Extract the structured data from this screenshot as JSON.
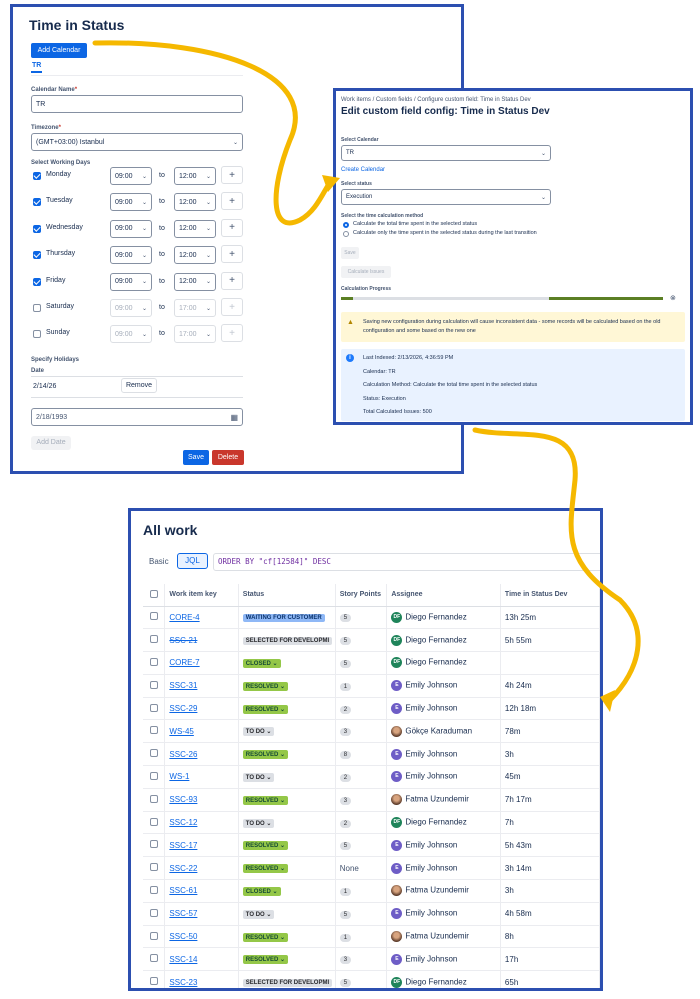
{
  "panel1": {
    "title": "Time in Status",
    "add_calendar_button": "Add Calendar",
    "tab_tr": "TR",
    "calendar_name_label": "Calendar Name",
    "required_mark": "*",
    "calendar_name_value": "TR",
    "timezone_label": "Timezone",
    "timezone_value": "(GMT+03:00) Istanbul",
    "working_days_label": "Select Working Days",
    "to_label": "to",
    "days": [
      {
        "name": "Monday",
        "checked": true,
        "start": "09:00",
        "end": "12:00"
      },
      {
        "name": "Tuesday",
        "checked": true,
        "start": "09:00",
        "end": "12:00"
      },
      {
        "name": "Wednesday",
        "checked": true,
        "start": "09:00",
        "end": "12:00"
      },
      {
        "name": "Thursday",
        "checked": true,
        "start": "09:00",
        "end": "12:00"
      },
      {
        "name": "Friday",
        "checked": true,
        "start": "09:00",
        "end": "12:00"
      },
      {
        "name": "Saturday",
        "checked": false,
        "start": "09:00",
        "end": "17:00"
      },
      {
        "name": "Sunday",
        "checked": false,
        "start": "09:00",
        "end": "17:00"
      }
    ],
    "holidays_label": "Specify Holidays",
    "date_label": "Date",
    "holiday_date": "2/14/26",
    "remove_button": "Remove",
    "date_input_value": "2/18/1993",
    "add_date_button": "Add Date",
    "save_button": "Save",
    "delete_button": "Delete"
  },
  "panel2": {
    "breadcrumb": [
      "Work items",
      "Custom fields",
      "Configure custom field: Time in Status Dev"
    ],
    "breadcrumb_sep": "/",
    "title": "Edit custom field config: Time in Status Dev",
    "select_calendar_label": "Select Calendar",
    "calendar_value": "TR",
    "create_calendar_link": "Create Calendar",
    "select_status_label": "Select status",
    "status_value": "Execution",
    "method_label": "Select the time calculation method",
    "method_options": [
      {
        "label": "Calculate the total time spent in the selected status",
        "selected": true
      },
      {
        "label": "Calculate only the time spent in the selected status during the last transition",
        "selected": false
      }
    ],
    "save_button": "Save",
    "calculate_button": "Calculate Issues",
    "progress_label": "Calculation Progress",
    "warning_text": "Saving new configuration during calculation will cause inconsistent data - some records will be calculated based on the old configuration and some based on the new one",
    "info": [
      "Last Indexed: 2/13/2026, 4:36:59 PM",
      "Calendar: TR",
      "Calculation Method: Calculate the total time spent in the selected status",
      "Status: Execution",
      "Total Calculated Issues: 500"
    ]
  },
  "panel3": {
    "title": "All work",
    "basic_label": "Basic",
    "jql_label": "JQL",
    "query": "ORDER BY \"cf[12584]\" DESC",
    "columns": [
      "Work item key",
      "Status",
      "Story Points",
      "Assignee",
      "Time in Status Dev"
    ],
    "rows": [
      {
        "key": "CORE-4",
        "strike": false,
        "status": "WAITING FOR CUSTOMER",
        "status_color": "blue",
        "chevron": false,
        "points": "5",
        "assignee": "Diego Fernandez",
        "avatar": "DF",
        "time": "13h 25m"
      },
      {
        "key": "SSC-21",
        "strike": true,
        "status": "SELECTED FOR DEVELOPMI",
        "status_color": "grey",
        "chevron": false,
        "points": "5",
        "assignee": "Diego Fernandez",
        "avatar": "DF",
        "time": "5h 55m"
      },
      {
        "key": "CORE-7",
        "strike": false,
        "status": "CLOSED",
        "status_color": "green",
        "chevron": true,
        "points": "5",
        "assignee": "Diego Fernandez",
        "avatar": "DF",
        "time": ""
      },
      {
        "key": "SSC-31",
        "strike": false,
        "status": "RESOLVED",
        "status_color": "green",
        "chevron": true,
        "points": "1",
        "assignee": "Emily Johnson",
        "avatar": "E",
        "time": "4h 24m"
      },
      {
        "key": "SSC-29",
        "strike": false,
        "status": "RESOLVED",
        "status_color": "green",
        "chevron": true,
        "points": "2",
        "assignee": "Emily Johnson",
        "avatar": "E",
        "time": "12h 18m"
      },
      {
        "key": "WS-45",
        "strike": false,
        "status": "TO DO",
        "status_color": "grey",
        "chevron": true,
        "points": "3",
        "assignee": "Gökçe Karaduman",
        "avatar": "photo",
        "time": "78m"
      },
      {
        "key": "SSC-26",
        "strike": false,
        "status": "RESOLVED",
        "status_color": "green",
        "chevron": true,
        "points": "8",
        "assignee": "Emily Johnson",
        "avatar": "E",
        "time": "3h"
      },
      {
        "key": "WS-1",
        "strike": false,
        "status": "TO DO",
        "status_color": "grey",
        "chevron": true,
        "points": "2",
        "assignee": "Emily Johnson",
        "avatar": "E",
        "time": "45m"
      },
      {
        "key": "SSC-93",
        "strike": false,
        "status": "RESOLVED",
        "status_color": "green",
        "chevron": true,
        "points": "3",
        "assignee": "Fatma Uzundemir",
        "avatar": "photo",
        "time": "7h 17m"
      },
      {
        "key": "SSC-12",
        "strike": false,
        "status": "TO DO",
        "status_color": "grey",
        "chevron": true,
        "points": "2",
        "assignee": "Diego Fernandez",
        "avatar": "DF",
        "time": "7h"
      },
      {
        "key": "SSC-17",
        "strike": false,
        "status": "RESOLVED",
        "status_color": "green",
        "chevron": true,
        "points": "5",
        "assignee": "Emily Johnson",
        "avatar": "E",
        "time": "5h 43m"
      },
      {
        "key": "SSC-22",
        "strike": false,
        "status": "RESOLVED",
        "status_color": "green",
        "chevron": true,
        "points": "None",
        "assignee": "Emily Johnson",
        "avatar": "E",
        "time": "3h 14m"
      },
      {
        "key": "SSC-61",
        "strike": false,
        "status": "CLOSED",
        "status_color": "green",
        "chevron": true,
        "points": "1",
        "assignee": "Fatma Uzundemir",
        "avatar": "photo",
        "time": "3h"
      },
      {
        "key": "SSC-57",
        "strike": false,
        "status": "TO DO",
        "status_color": "grey",
        "chevron": true,
        "points": "5",
        "assignee": "Emily Johnson",
        "avatar": "E",
        "time": "4h 58m"
      },
      {
        "key": "SSC-50",
        "strike": false,
        "status": "RESOLVED",
        "status_color": "green",
        "chevron": true,
        "points": "1",
        "assignee": "Fatma Uzundemir",
        "avatar": "photo",
        "time": "8h"
      },
      {
        "key": "SSC-14",
        "strike": false,
        "status": "RESOLVED",
        "status_color": "green",
        "chevron": true,
        "points": "3",
        "assignee": "Emily Johnson",
        "avatar": "E",
        "time": "17h"
      },
      {
        "key": "SSC-23",
        "strike": false,
        "status": "SELECTED FOR DEVELOPMI",
        "status_color": "grey",
        "chevron": false,
        "points": "5",
        "assignee": "Diego Fernandez",
        "avatar": "DF",
        "time": "65h"
      }
    ]
  },
  "colors": {
    "accent": "#0c66e4",
    "frame": "#2c4fb0",
    "arrow": "#f5b800",
    "danger": "#c9372c",
    "progress": "#5b7f24"
  }
}
